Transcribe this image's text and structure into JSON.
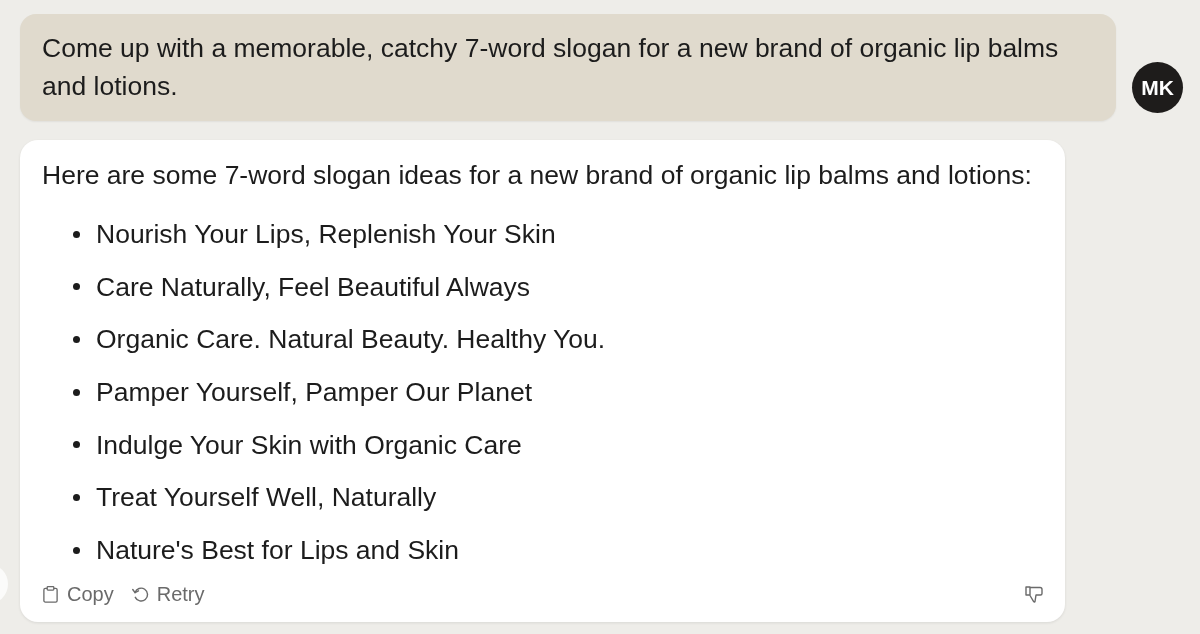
{
  "user_message": {
    "text": "Come up with a memorable, catchy 7-word slogan for a new brand of organic lip balms and lotions.",
    "avatar": {
      "initials": "MK"
    }
  },
  "response": {
    "intro": "Here are some 7-word slogan ideas for a new brand of organic lip balms and lotions:",
    "items": [
      "Nourish Your Lips, Replenish Your Skin",
      "Care Naturally, Feel Beautiful Always",
      "Organic Care. Natural Beauty. Healthy You.",
      "Pamper Yourself, Pamper Our Planet",
      "Indulge Your Skin with Organic Care",
      "Treat Yourself Well, Naturally",
      "Nature's Best for Lips and Skin"
    ],
    "actions": [
      {
        "kind": "copy",
        "label": "Copy"
      },
      {
        "kind": "retry",
        "label": "Retry"
      }
    ]
  }
}
